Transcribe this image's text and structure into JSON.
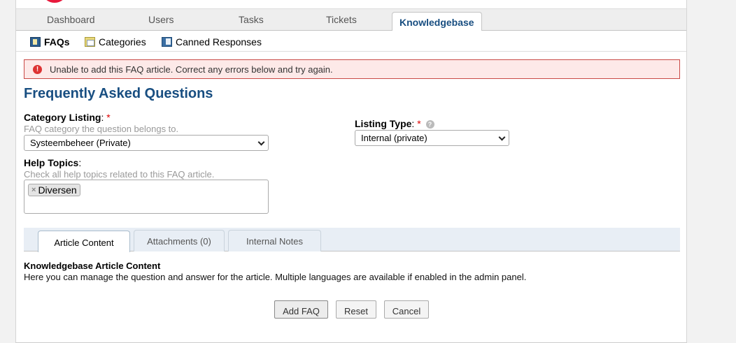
{
  "nav": {
    "tabs": [
      {
        "label": "Dashboard"
      },
      {
        "label": "Users"
      },
      {
        "label": "Tasks"
      },
      {
        "label": "Tickets"
      },
      {
        "label": "Knowledgebase"
      }
    ],
    "active_tab": "Knowledgebase"
  },
  "subnav": {
    "items": [
      {
        "label": "FAQs",
        "icon": "faq-icon"
      },
      {
        "label": "Categories",
        "icon": "categories-icon"
      },
      {
        "label": "Canned Responses",
        "icon": "canned-responses-icon"
      }
    ],
    "active_item": "FAQs"
  },
  "error": {
    "message": "Unable to add this FAQ article. Correct any errors below and try again.",
    "icon_glyph": "!"
  },
  "page": {
    "title": "Frequently Asked Questions"
  },
  "form": {
    "category": {
      "label": "Category Listing",
      "colon": ":",
      "required_mark": "*",
      "hint": "FAQ category the question belongs to.",
      "value": "Systeembeheer (Private)"
    },
    "listing_type": {
      "label": "Listing Type",
      "colon": ":",
      "required_mark": "*",
      "help_glyph": "?",
      "value": "Internal (private)"
    },
    "help_topics": {
      "label": "Help Topics",
      "colon": ":",
      "hint": "Check all help topics related to this FAQ article.",
      "chip_remove": "×",
      "selected": [
        "Diversen"
      ]
    }
  },
  "tabs": [
    {
      "label": "Article Content"
    },
    {
      "label": "Attachments (0)"
    },
    {
      "label": "Internal Notes"
    }
  ],
  "active_tab": "Article Content",
  "content": {
    "title": "Knowledgebase Article Content",
    "description": "Here you can manage the question and answer for the article. Multiple languages are available if enabled in the admin panel."
  },
  "buttons": {
    "add": "Add FAQ",
    "reset": "Reset",
    "cancel": "Cancel"
  },
  "colors": {
    "accent": "#184e81",
    "error_bg": "#fde9e8",
    "error_border": "#c94946",
    "required": "#dd0000"
  }
}
